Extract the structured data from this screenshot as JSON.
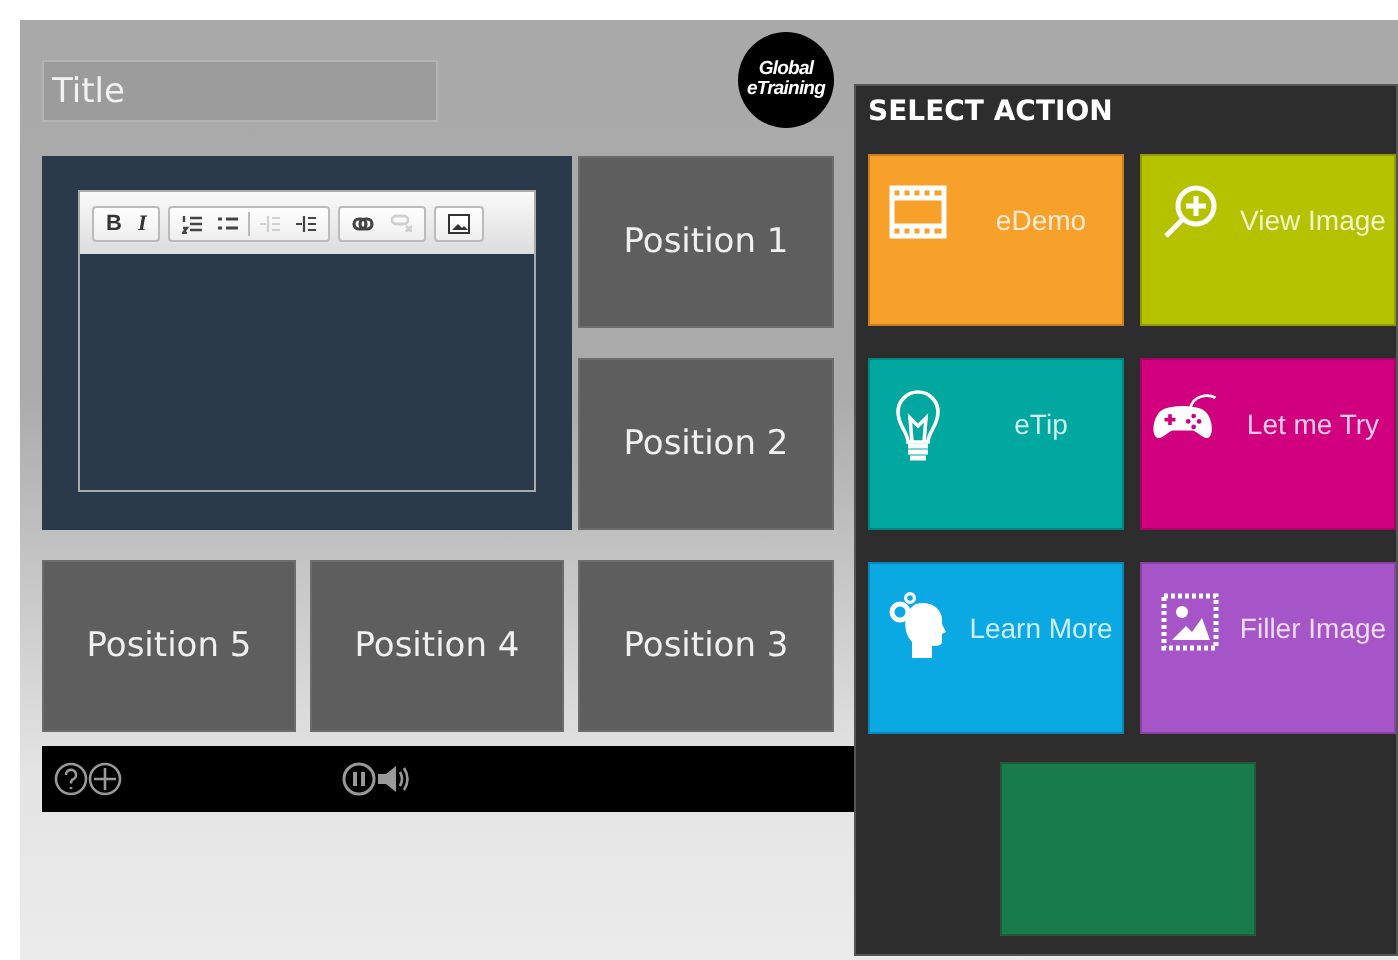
{
  "title_field": {
    "placeholder": "Title"
  },
  "logo": {
    "line_1": "Global",
    "line_2": "eTraining"
  },
  "editor": {
    "toolbar_groups": [
      [
        {
          "kind": "bold",
          "label": "B",
          "disabled": false
        },
        {
          "kind": "italic",
          "label": "I",
          "disabled": false
        }
      ],
      [
        {
          "kind": "ordered-list",
          "disabled": false
        },
        {
          "kind": "bullet-list",
          "disabled": false
        },
        {
          "kind": "separator"
        },
        {
          "kind": "outdent",
          "disabled": true
        },
        {
          "kind": "indent",
          "disabled": false
        }
      ],
      [
        {
          "kind": "link",
          "disabled": false
        },
        {
          "kind": "unlink",
          "disabled": true
        }
      ],
      [
        {
          "kind": "image",
          "disabled": false
        }
      ]
    ]
  },
  "positions": [
    {
      "label": "Position 1"
    },
    {
      "label": "Position 2"
    },
    {
      "label": "Position 5"
    },
    {
      "label": "Position 4"
    },
    {
      "label": "Position 3"
    }
  ],
  "select_action": {
    "title": "SELECT ACTION",
    "tiles": [
      {
        "kind": "film",
        "label": "eDemo",
        "color": "#f7a02a"
      },
      {
        "kind": "zoom",
        "label": "View Image",
        "color": "#b5c200"
      },
      {
        "kind": "bulb",
        "label": "eTip",
        "color": "#00a8a0"
      },
      {
        "kind": "gamepad",
        "label": "Let me Try",
        "color": "#d0007f"
      },
      {
        "kind": "head",
        "label": "Learn More",
        "color": "#0ba9e3"
      },
      {
        "kind": "photo",
        "label": "Filler Image",
        "color": "#a555c8"
      }
    ]
  }
}
